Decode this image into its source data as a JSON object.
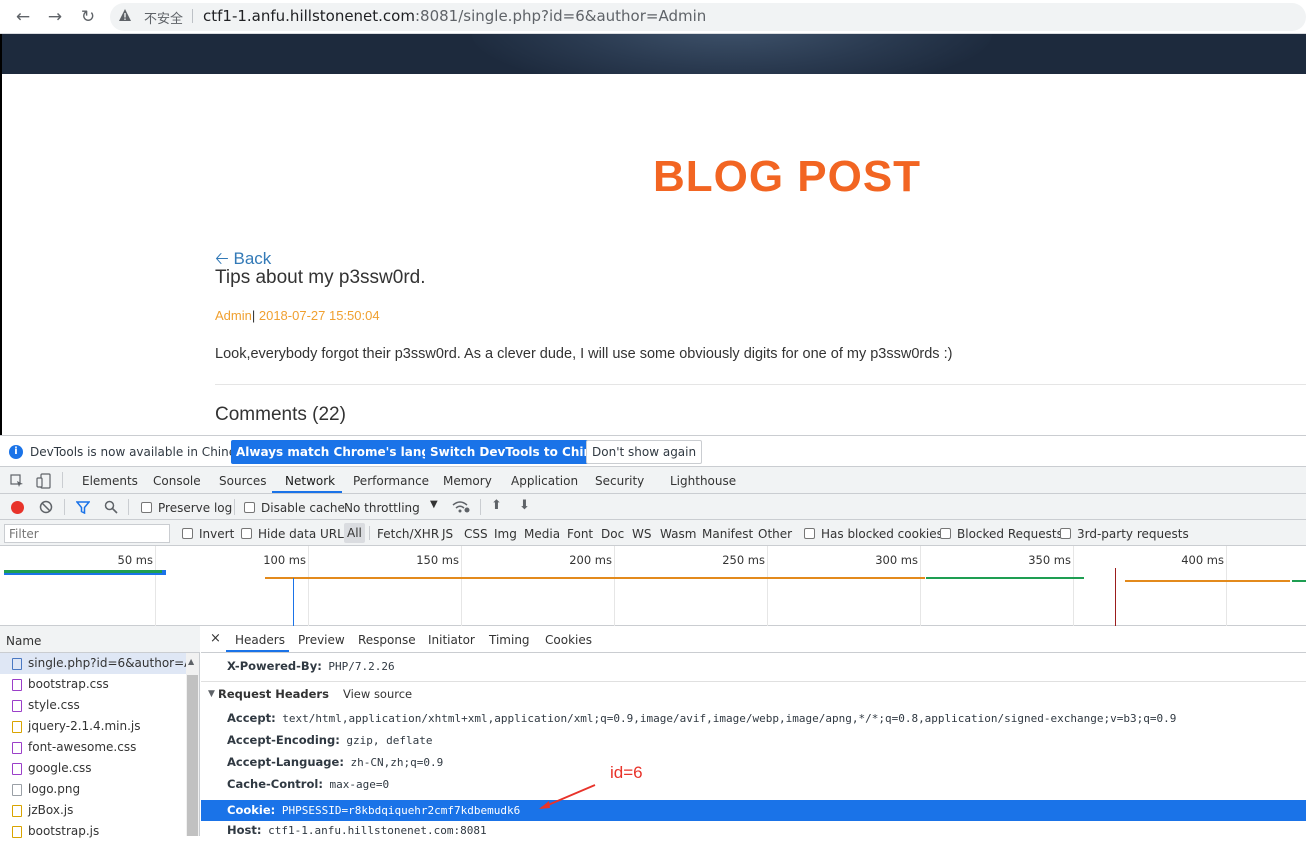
{
  "browser": {
    "insecure_label": "不安全",
    "url_host": "ctf1-1.anfu.hillstonenet.com",
    "url_rest": ":8081/single.php?id=6&author=Admin"
  },
  "page": {
    "blog_title": "BLOG POST",
    "back_label": "Back",
    "post_title": "Tips about my p3ssw0rd.",
    "author": "Admin",
    "meta_sep": "|",
    "date": " 2018-07-27 15:50:04",
    "body": "Look,everybody forgot their p3ssw0rd. As a clever dude, I will use some obviously digits for one of my p3ssw0rds :)",
    "comments": "Comments (22)"
  },
  "devtools": {
    "info_msg": "DevTools is now available in Chinese!",
    "btn_match": "Always match Chrome's language",
    "btn_switch": "Switch DevTools to Chinese",
    "btn_dont": "Don't show again",
    "tabs": [
      "Elements",
      "Console",
      "Sources",
      "Network",
      "Performance",
      "Memory",
      "Application",
      "Security",
      "Lighthouse"
    ],
    "active_tab": "Network",
    "toolbar": {
      "preserve_log": "Preserve log",
      "disable_cache": "Disable cache",
      "throttling": "No throttling"
    },
    "filter": {
      "placeholder": "Filter",
      "invert": "Invert",
      "hide_data": "Hide data URLs",
      "types": [
        "All",
        "Fetch/XHR",
        "JS",
        "CSS",
        "Img",
        "Media",
        "Font",
        "Doc",
        "WS",
        "Wasm",
        "Manifest",
        "Other"
      ],
      "blocked_cookies": "Has blocked cookies",
      "blocked_requests": "Blocked Requests",
      "third_party": "3rd-party requests"
    },
    "timeline_ticks": [
      "50 ms",
      "100 ms",
      "150 ms",
      "200 ms",
      "250 ms",
      "300 ms",
      "350 ms",
      "400 ms"
    ],
    "name_header": "Name",
    "requests": [
      "single.php?id=6&author=Ad...",
      "bootstrap.css",
      "style.css",
      "jquery-2.1.4.min.js",
      "font-awesome.css",
      "google.css",
      "logo.png",
      "jzBox.js",
      "bootstrap.js"
    ],
    "detail_tabs": [
      "Headers",
      "Preview",
      "Response",
      "Initiator",
      "Timing",
      "Cookies"
    ],
    "active_detail_tab": "Headers",
    "powered_by": {
      "key": "X-Powered-By:",
      "value": "PHP/7.2.26"
    },
    "request_headers_title": "Request Headers",
    "view_source": "View source",
    "headers": [
      {
        "key": "Accept:",
        "value": "text/html,application/xhtml+xml,application/xml;q=0.9,image/avif,image/webp,image/apng,*/*;q=0.8,application/signed-exchange;v=b3;q=0.9"
      },
      {
        "key": "Accept-Encoding:",
        "value": "gzip, deflate"
      },
      {
        "key": "Accept-Language:",
        "value": "zh-CN,zh;q=0.9"
      },
      {
        "key": "Cache-Control:",
        "value": "max-age=0"
      },
      {
        "key": "Cookie:",
        "value": "PHPSESSID=r8kbdqiquehr2cmf7kdbemudk6"
      },
      {
        "key": "Host:",
        "value": "ctf1-1.anfu.hillstonenet.com:8081"
      }
    ]
  },
  "annotation": "id=6",
  "colors": {
    "accent": "#1a73e8",
    "blog_title": "#f26522",
    "annotation": "#e8332a"
  }
}
